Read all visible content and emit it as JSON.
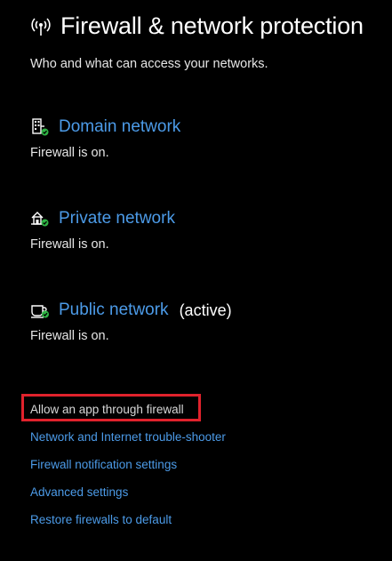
{
  "header": {
    "title": "Firewall & network protection",
    "subtitle": "Who and what can access your networks.",
    "icon": "wireless-signal-icon"
  },
  "networks": [
    {
      "label": "Domain network",
      "status": "Firewall is on.",
      "active_label": "",
      "icon": "domain-network-icon"
    },
    {
      "label": "Private network",
      "status": "Firewall is on.",
      "active_label": "",
      "icon": "private-network-icon"
    },
    {
      "label": "Public network",
      "status": "Firewall is on.",
      "active_label": "(active)",
      "icon": "public-network-icon"
    }
  ],
  "links": {
    "allow_app": "Allow an app through firewall",
    "troubleshooter": "Network and Internet trouble-shooter",
    "notification_settings": "Firewall notification settings",
    "advanced_settings": "Advanced settings",
    "restore_defaults": "Restore firewalls to default"
  },
  "colors": {
    "background": "#000000",
    "link": "#4c9be8",
    "text": "#ffffff",
    "highlight_box": "#e0222c",
    "check_badge": "#2fb344"
  }
}
